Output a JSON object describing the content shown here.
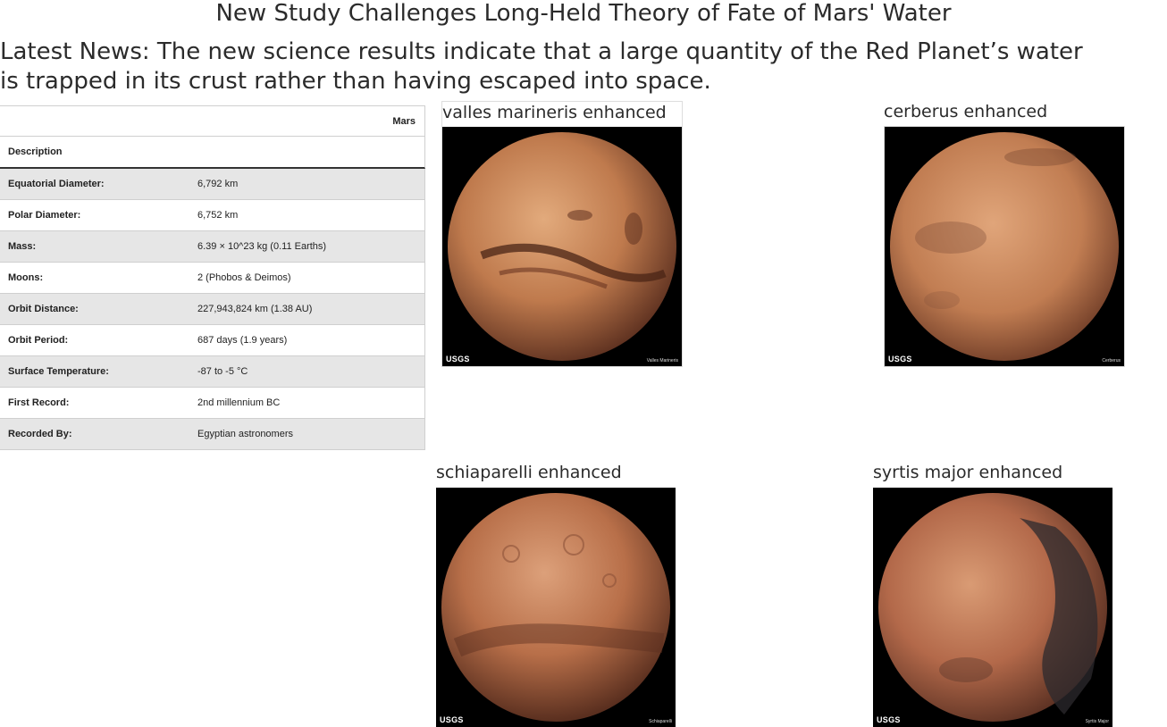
{
  "news": {
    "title": "New Study Challenges Long-Held Theory of Fate of Mars' Water",
    "paragraph": "Latest News: The new science results indicate that a large quantity of the Red Planet’s water is trapped in its crust rather than having escaped into space."
  },
  "facts": {
    "planet_header": "Mars",
    "description_header": "Description",
    "rows": [
      {
        "label": "Equatorial Diameter:",
        "value": "6,792 km"
      },
      {
        "label": "Polar Diameter:",
        "value": "6,752 km"
      },
      {
        "label": "Mass:",
        "value": "6.39 × 10^23 kg (0.11 Earths)"
      },
      {
        "label": "Moons:",
        "value": "2 (Phobos & Deimos)"
      },
      {
        "label": "Orbit Distance:",
        "value": "227,943,824 km (1.38 AU)"
      },
      {
        "label": "Orbit Period:",
        "value": "687 days (1.9 years)"
      },
      {
        "label": "Surface Temperature:",
        "value": "-87 to -5 °C"
      },
      {
        "label": "First Record:",
        "value": "2nd millennium BC"
      },
      {
        "label": "Recorded By:",
        "value": "Egyptian astronomers"
      }
    ]
  },
  "hemispheres": [
    {
      "title": "valles marineris enhanced",
      "logo": "USGS",
      "credit": "Valles Marineris"
    },
    {
      "title": "cerberus enhanced",
      "logo": "USGS",
      "credit": "Cerberus"
    },
    {
      "title": "schiaparelli enhanced",
      "logo": "USGS",
      "credit": "Schiaparelli"
    },
    {
      "title": "syrtis major enhanced",
      "logo": "USGS",
      "credit": "Syrtis Major"
    }
  ],
  "colors": {
    "mars_light": "#d79a6c",
    "mars_mid": "#b06a43",
    "mars_dark": "#5a3020",
    "table_stripe": "#e6e6e6"
  }
}
